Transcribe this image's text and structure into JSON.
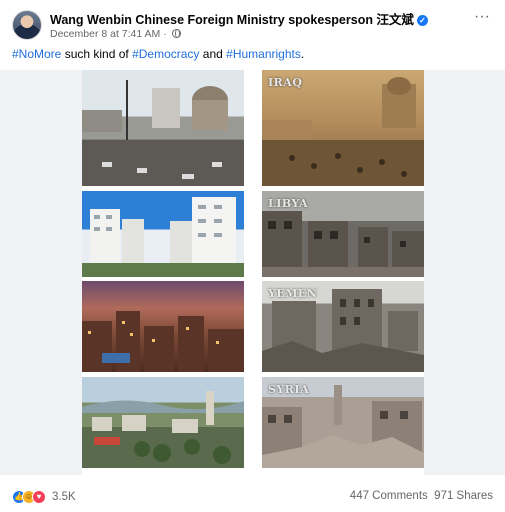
{
  "post": {
    "author": "Wang Wenbin Chinese Foreign Ministry spokesperson 汪文斌",
    "timestamp": "December 8 at 7:41 AM ·",
    "text": {
      "hashtag_1": "#NoMore",
      "plain_1": " such kind of ",
      "hashtag_2": "#Democracy",
      "plain_2": " and ",
      "hashtag_3": "#Humanrights",
      "plain_3": "."
    }
  },
  "collage": {
    "labels": {
      "iraq": "IRAQ",
      "libya": "LIBYA",
      "yemen": "YEMEN",
      "syria": "SYRIA"
    }
  },
  "footer": {
    "reaction_count": "3.5K",
    "comments": "447 Comments",
    "shares": "971 Shares"
  },
  "icons": {
    "verified": "verified-badge-icon",
    "privacy": "globe-icon",
    "more": "more-options-icon",
    "reactions": [
      "like-icon",
      "haha-icon",
      "love-icon"
    ]
  },
  "colors": {
    "link": "#216fdb",
    "verified": "#1877f2",
    "secondary_text": "#65676b"
  }
}
